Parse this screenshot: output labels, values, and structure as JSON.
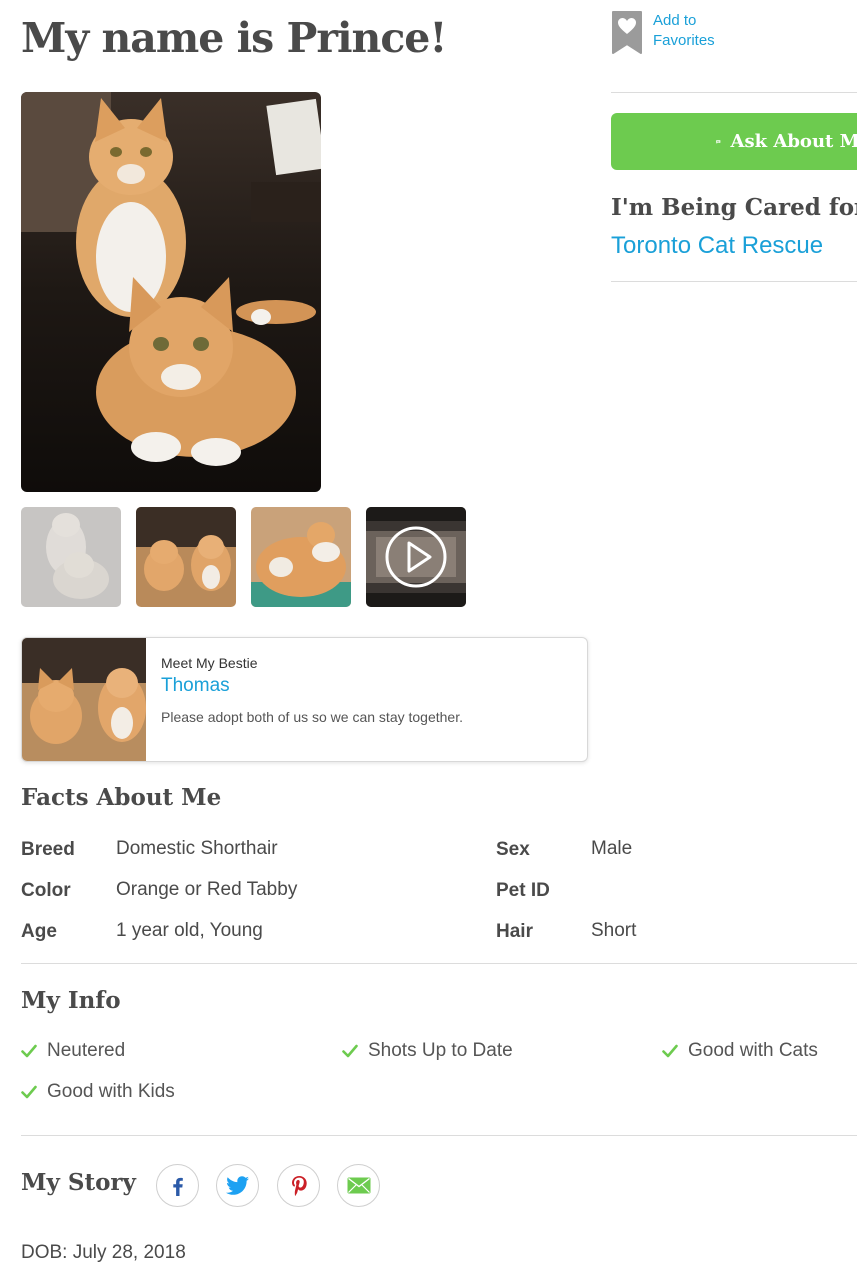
{
  "header": {
    "title": "My name is Prince!"
  },
  "favorites": {
    "label_line1": "Add to",
    "label_line2": "Favorites"
  },
  "ask": {
    "label": "Ask About Me"
  },
  "care": {
    "heading": "I'm Being Cared for by",
    "org": "Toronto Cat Rescue"
  },
  "gallery": {
    "thumbs": [
      "photo-1",
      "photo-2",
      "photo-3",
      "video"
    ]
  },
  "bestie": {
    "kicker": "Meet My Bestie",
    "name": "Thomas",
    "description": "Please adopt both of us so we can stay together."
  },
  "facts": {
    "heading": "Facts About Me",
    "rows": [
      {
        "label": "Breed",
        "value": "Domestic Shorthair"
      },
      {
        "label": "Color",
        "value": "Orange or Red Tabby"
      },
      {
        "label": "Age",
        "value": "1 year old, Young"
      },
      {
        "label": "Sex",
        "value": "Male"
      },
      {
        "label": "Pet ID",
        "value": ""
      },
      {
        "label": "Hair",
        "value": "Short"
      }
    ]
  },
  "info": {
    "heading": "My Info",
    "items": [
      "Neutered",
      "Shots Up to Date",
      "Good with Cats",
      "Good with Kids"
    ]
  },
  "story": {
    "heading": "My Story",
    "share": [
      "facebook-icon",
      "twitter-icon",
      "pinterest-icon",
      "email-icon"
    ],
    "dob": "DOB: July 28, 2018"
  },
  "colors": {
    "link": "#1aa0d8",
    "accent_green": "#6dcb4f",
    "text": "#4a4a4a"
  }
}
